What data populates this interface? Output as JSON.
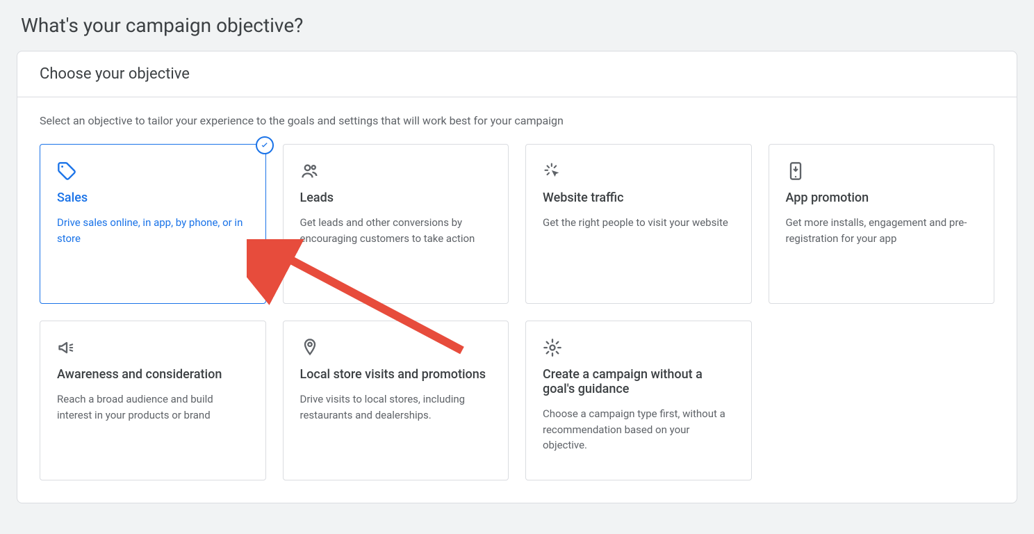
{
  "page_title": "What's your campaign objective?",
  "panel": {
    "header": "Choose your objective",
    "instruction": "Select an objective to tailor your experience to the goals and settings that will work best for your campaign"
  },
  "objectives": [
    {
      "id": "sales",
      "title": "Sales",
      "desc": "Drive sales online, in app, by phone, or in store",
      "selected": true,
      "icon": "tag-icon"
    },
    {
      "id": "leads",
      "title": "Leads",
      "desc": "Get leads and other conversions by encouraging customers to take action",
      "selected": false,
      "icon": "people-icon"
    },
    {
      "id": "website-traffic",
      "title": "Website traffic",
      "desc": "Get the right people to visit your website",
      "selected": false,
      "icon": "click-icon"
    },
    {
      "id": "app-promotion",
      "title": "App promotion",
      "desc": "Get more installs, engagement and pre-registration for your app",
      "selected": false,
      "icon": "phone-icon"
    },
    {
      "id": "awareness",
      "title": "Awareness and consideration",
      "desc": "Reach a broad audience and build interest in your products or brand",
      "selected": false,
      "icon": "megaphone-icon"
    },
    {
      "id": "local-store",
      "title": "Local store visits and promotions",
      "desc": "Drive visits to local stores, including restaurants and dealerships.",
      "selected": false,
      "icon": "pin-icon"
    },
    {
      "id": "no-goal",
      "title": "Create a campaign without a goal's guidance",
      "desc": "Choose a campaign type first, without a recommendation based on your objective.",
      "selected": false,
      "icon": "gear-icon"
    }
  ],
  "colors": {
    "accent": "#1a73e8",
    "border": "#dadce0",
    "text_primary": "#3c4043",
    "text_secondary": "#5f6368",
    "page_bg": "#f1f3f4",
    "annotation": "#e74c3c"
  }
}
